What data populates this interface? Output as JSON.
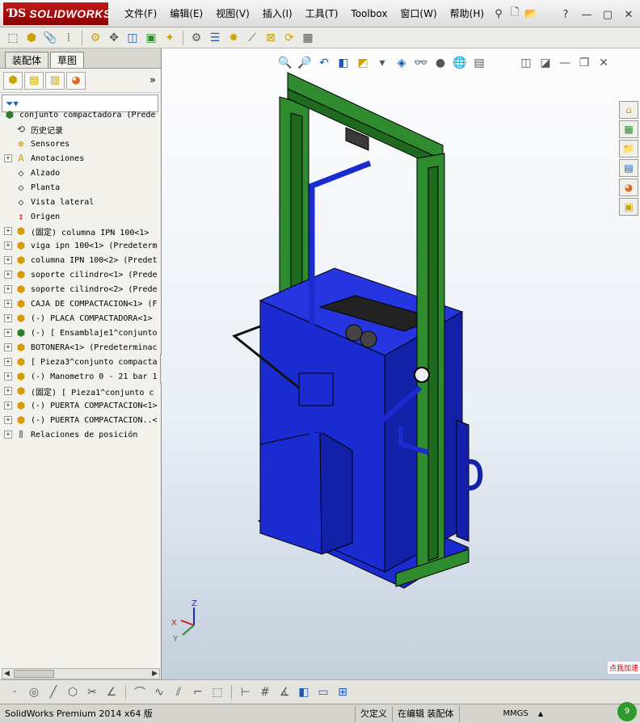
{
  "app": {
    "logo_ds": "ƊS",
    "logo_name": "SOLIDWORKS"
  },
  "menu": [
    "文件(F)",
    "编辑(E)",
    "视图(V)",
    "插入(I)",
    "工具(T)",
    "Toolbox",
    "窗口(W)",
    "帮助(H)"
  ],
  "window_controls": {
    "help": "?",
    "min": "—",
    "max": "▢",
    "close": "✕"
  },
  "panel_tabs": [
    "装配体",
    "草图"
  ],
  "tree": {
    "root": "conjunto compactadora  (Prede",
    "items": [
      {
        "label": "历史记录",
        "icon": "history-icon",
        "expand": false
      },
      {
        "label": "Sensores",
        "icon": "sensor-icon",
        "expand": false
      },
      {
        "label": "Anotaciones",
        "icon": "annotation-icon",
        "expand": true
      },
      {
        "label": "Alzado",
        "icon": "plane-icon",
        "expand": false
      },
      {
        "label": "Planta",
        "icon": "plane-icon",
        "expand": false
      },
      {
        "label": "Vista lateral",
        "icon": "plane-icon",
        "expand": false
      },
      {
        "label": "Origen",
        "icon": "origin-icon",
        "expand": false
      },
      {
        "label": "(固定) columna IPN 100<1>",
        "icon": "part-icon",
        "expand": true
      },
      {
        "label": "viga ipn 100<1> (Predeterm",
        "icon": "part-icon",
        "expand": true
      },
      {
        "label": "columna IPN 100<2> (Predet",
        "icon": "part-icon",
        "expand": true
      },
      {
        "label": "soporte cilindro<1> (Prede",
        "icon": "part-icon",
        "expand": true
      },
      {
        "label": "soporte cilindro<2> (Prede",
        "icon": "part-icon",
        "expand": true
      },
      {
        "label": "CAJA DE COMPACTACION<1> (F",
        "icon": "part-icon",
        "expand": true
      },
      {
        "label": "(-) PLACA COMPACTADORA<1>",
        "icon": "part-icon",
        "expand": true
      },
      {
        "label": "(-) [ Ensamblaje1^conjunto",
        "icon": "assembly-icon",
        "expand": true
      },
      {
        "label": "BOTONERA<1> (Predeterminac",
        "icon": "part-icon",
        "expand": true
      },
      {
        "label": "[ Pieza3^conjunto compacta",
        "icon": "part-icon",
        "expand": true
      },
      {
        "label": "(-) Manometro 0 - 21 bar 1",
        "icon": "part-icon",
        "expand": true
      },
      {
        "label": "(固定) [ Pieza1^conjunto c",
        "icon": "part-icon",
        "expand": true
      },
      {
        "label": "(-) PUERTA COMPACTACION<1>",
        "icon": "part-icon",
        "expand": true
      },
      {
        "label": "(-) PUERTA COMPACTACION..<",
        "icon": "part-icon",
        "expand": true
      },
      {
        "label": "Relaciones de posición",
        "icon": "mates-icon",
        "expand": true
      }
    ]
  },
  "triad": {
    "x": "X",
    "y": "Y",
    "z": "Z"
  },
  "status": {
    "product": "SolidWorks Premium 2014 x64 版",
    "state": "欠定义",
    "editing": "在编辑 装配体",
    "units": "MMGS",
    "units_arrow": "▲"
  },
  "badge": {
    "text": "点我加速",
    "number": "9"
  },
  "colors": {
    "frame": "#2e8b2e",
    "box": "#1a2bd0",
    "brand": "#b30000"
  }
}
